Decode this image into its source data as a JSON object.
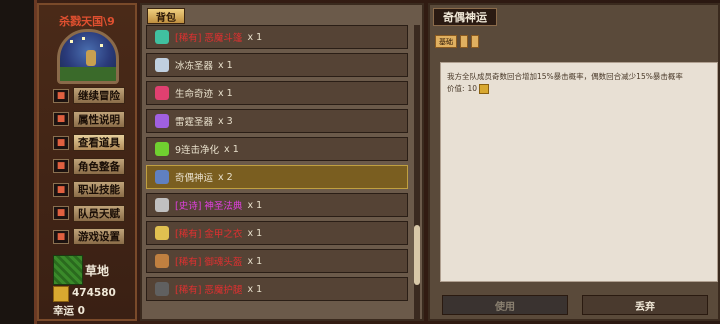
{
  "left_panel": {
    "title": "杀戮天国\\9",
    "menu": [
      {
        "label": "继续冒险",
        "icon": "map-icon"
      },
      {
        "label": "属性说明",
        "icon": "book-icon"
      },
      {
        "label": "查看道具",
        "icon": "bag-icon"
      },
      {
        "label": "角色整备",
        "icon": "armor-icon"
      },
      {
        "label": "职业技能",
        "icon": "skill-icon"
      },
      {
        "label": "队员天赋",
        "icon": "talent-icon"
      },
      {
        "label": "游戏设置",
        "icon": "gear-icon"
      }
    ],
    "terrain": "草地",
    "gold": "474580",
    "luck": "幸运 0"
  },
  "inventory": {
    "header": "背包",
    "items": [
      {
        "name": "[稀有] 恶魔斗篷",
        "qty": "x 1",
        "color": "red",
        "icon_color": "#40c0a0"
      },
      {
        "name": "冰冻圣器",
        "qty": "x 1",
        "color": "normal",
        "icon_color": "#c0d0e0"
      },
      {
        "name": "生命奇迹",
        "qty": "x 1",
        "color": "normal",
        "icon_color": "#e04070"
      },
      {
        "name": "雷霆圣器",
        "qty": "x 3",
        "color": "normal",
        "icon_color": "#a060e0"
      },
      {
        "name": "9连击净化",
        "qty": "x 1",
        "color": "normal",
        "icon_color": "#70d030"
      },
      {
        "name": "奇偶神运",
        "qty": "x 2",
        "color": "normal",
        "icon_color": "#6080c0"
      },
      {
        "name": "[史诗] 神圣法典",
        "qty": "x 1",
        "color": "pink",
        "icon_color": "#c0c0c0"
      },
      {
        "name": "[稀有] 金甲之衣",
        "qty": "x 1",
        "color": "red",
        "icon_color": "#e0c050"
      },
      {
        "name": "[稀有] 御魂头盔",
        "qty": "x 1",
        "color": "red",
        "icon_color": "#c08040"
      },
      {
        "name": "[稀有] 恶魔护腿",
        "qty": "x 1",
        "color": "red",
        "icon_color": "#606060"
      }
    ],
    "selected_index": 5
  },
  "detail": {
    "title": "奇偶神运",
    "tab_label": "基础",
    "description": "我方全队成员奇数回合增加15%暴击概率，偶数回合减少15%暴击概率",
    "price_label": "价值:",
    "price_value": "10",
    "use_label": "使用",
    "discard_label": "丢弃"
  }
}
